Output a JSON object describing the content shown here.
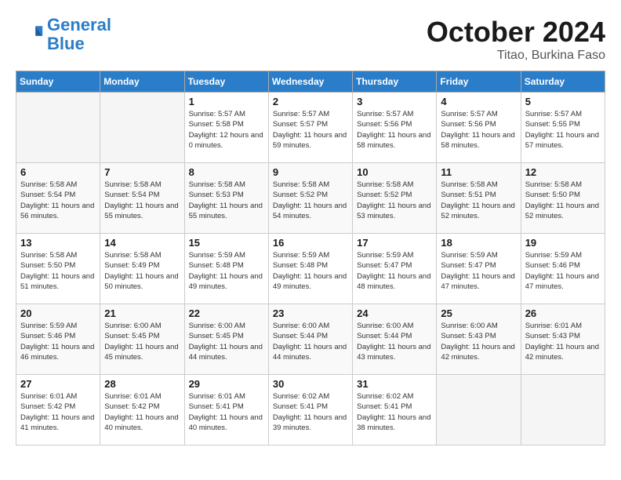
{
  "header": {
    "logo_line1": "General",
    "logo_line2": "Blue",
    "month_title": "October 2024",
    "subtitle": "Titao, Burkina Faso"
  },
  "days_of_week": [
    "Sunday",
    "Monday",
    "Tuesday",
    "Wednesday",
    "Thursday",
    "Friday",
    "Saturday"
  ],
  "weeks": [
    [
      {
        "num": "",
        "empty": true
      },
      {
        "num": "",
        "empty": true
      },
      {
        "num": "1",
        "sunrise": "5:57 AM",
        "sunset": "5:58 PM",
        "daylight": "12 hours and 0 minutes."
      },
      {
        "num": "2",
        "sunrise": "5:57 AM",
        "sunset": "5:57 PM",
        "daylight": "11 hours and 59 minutes."
      },
      {
        "num": "3",
        "sunrise": "5:57 AM",
        "sunset": "5:56 PM",
        "daylight": "11 hours and 58 minutes."
      },
      {
        "num": "4",
        "sunrise": "5:57 AM",
        "sunset": "5:56 PM",
        "daylight": "11 hours and 58 minutes."
      },
      {
        "num": "5",
        "sunrise": "5:57 AM",
        "sunset": "5:55 PM",
        "daylight": "11 hours and 57 minutes."
      }
    ],
    [
      {
        "num": "6",
        "sunrise": "5:58 AM",
        "sunset": "5:54 PM",
        "daylight": "11 hours and 56 minutes."
      },
      {
        "num": "7",
        "sunrise": "5:58 AM",
        "sunset": "5:54 PM",
        "daylight": "11 hours and 55 minutes."
      },
      {
        "num": "8",
        "sunrise": "5:58 AM",
        "sunset": "5:53 PM",
        "daylight": "11 hours and 55 minutes."
      },
      {
        "num": "9",
        "sunrise": "5:58 AM",
        "sunset": "5:52 PM",
        "daylight": "11 hours and 54 minutes."
      },
      {
        "num": "10",
        "sunrise": "5:58 AM",
        "sunset": "5:52 PM",
        "daylight": "11 hours and 53 minutes."
      },
      {
        "num": "11",
        "sunrise": "5:58 AM",
        "sunset": "5:51 PM",
        "daylight": "11 hours and 52 minutes."
      },
      {
        "num": "12",
        "sunrise": "5:58 AM",
        "sunset": "5:50 PM",
        "daylight": "11 hours and 52 minutes."
      }
    ],
    [
      {
        "num": "13",
        "sunrise": "5:58 AM",
        "sunset": "5:50 PM",
        "daylight": "11 hours and 51 minutes."
      },
      {
        "num": "14",
        "sunrise": "5:58 AM",
        "sunset": "5:49 PM",
        "daylight": "11 hours and 50 minutes."
      },
      {
        "num": "15",
        "sunrise": "5:59 AM",
        "sunset": "5:48 PM",
        "daylight": "11 hours and 49 minutes."
      },
      {
        "num": "16",
        "sunrise": "5:59 AM",
        "sunset": "5:48 PM",
        "daylight": "11 hours and 49 minutes."
      },
      {
        "num": "17",
        "sunrise": "5:59 AM",
        "sunset": "5:47 PM",
        "daylight": "11 hours and 48 minutes."
      },
      {
        "num": "18",
        "sunrise": "5:59 AM",
        "sunset": "5:47 PM",
        "daylight": "11 hours and 47 minutes."
      },
      {
        "num": "19",
        "sunrise": "5:59 AM",
        "sunset": "5:46 PM",
        "daylight": "11 hours and 47 minutes."
      }
    ],
    [
      {
        "num": "20",
        "sunrise": "5:59 AM",
        "sunset": "5:46 PM",
        "daylight": "11 hours and 46 minutes."
      },
      {
        "num": "21",
        "sunrise": "6:00 AM",
        "sunset": "5:45 PM",
        "daylight": "11 hours and 45 minutes."
      },
      {
        "num": "22",
        "sunrise": "6:00 AM",
        "sunset": "5:45 PM",
        "daylight": "11 hours and 44 minutes."
      },
      {
        "num": "23",
        "sunrise": "6:00 AM",
        "sunset": "5:44 PM",
        "daylight": "11 hours and 44 minutes."
      },
      {
        "num": "24",
        "sunrise": "6:00 AM",
        "sunset": "5:44 PM",
        "daylight": "11 hours and 43 minutes."
      },
      {
        "num": "25",
        "sunrise": "6:00 AM",
        "sunset": "5:43 PM",
        "daylight": "11 hours and 42 minutes."
      },
      {
        "num": "26",
        "sunrise": "6:01 AM",
        "sunset": "5:43 PM",
        "daylight": "11 hours and 42 minutes."
      }
    ],
    [
      {
        "num": "27",
        "sunrise": "6:01 AM",
        "sunset": "5:42 PM",
        "daylight": "11 hours and 41 minutes."
      },
      {
        "num": "28",
        "sunrise": "6:01 AM",
        "sunset": "5:42 PM",
        "daylight": "11 hours and 40 minutes."
      },
      {
        "num": "29",
        "sunrise": "6:01 AM",
        "sunset": "5:41 PM",
        "daylight": "11 hours and 40 minutes."
      },
      {
        "num": "30",
        "sunrise": "6:02 AM",
        "sunset": "5:41 PM",
        "daylight": "11 hours and 39 minutes."
      },
      {
        "num": "31",
        "sunrise": "6:02 AM",
        "sunset": "5:41 PM",
        "daylight": "11 hours and 38 minutes."
      },
      {
        "num": "",
        "empty": true
      },
      {
        "num": "",
        "empty": true
      }
    ]
  ]
}
